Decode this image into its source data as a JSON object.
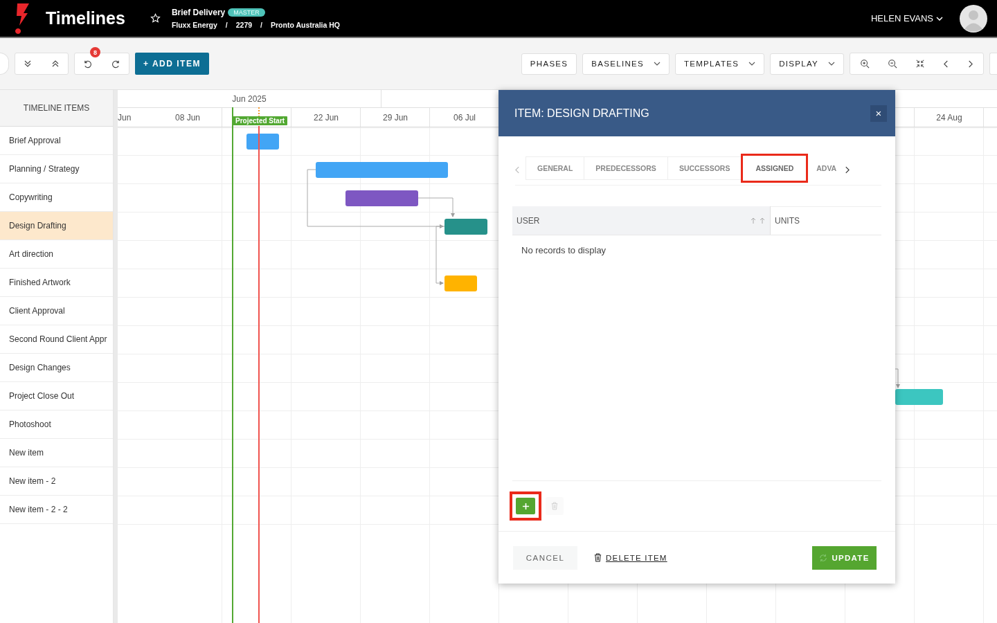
{
  "header": {
    "app_title": "Timelines",
    "project": "Brief Delivery",
    "badge": "MASTER",
    "breadcrumb": [
      "Fluxx Energy",
      "/",
      "2279",
      "/",
      "Pronto Australia HQ"
    ],
    "user": "HELEN EVANS"
  },
  "toolbar": {
    "undo_badge": "8",
    "add_item": "+ ADD ITEM",
    "buttons": [
      {
        "label": "PHASES",
        "dropdown": false
      },
      {
        "label": "BASELINES",
        "dropdown": true
      },
      {
        "label": "TEMPLATES",
        "dropdown": true
      },
      {
        "label": "DISPLAY",
        "dropdown": true
      }
    ]
  },
  "items_panel": {
    "heading": "TIMELINE ITEMS",
    "items": [
      {
        "label": "Brief Approval",
        "selected": false
      },
      {
        "label": "Planning / Strategy",
        "selected": false
      },
      {
        "label": "Copywriting",
        "selected": false
      },
      {
        "label": "Design Drafting",
        "selected": true
      },
      {
        "label": "Art direction",
        "selected": false
      },
      {
        "label": "Finished Artwork",
        "selected": false
      },
      {
        "label": "Client Approval",
        "selected": false
      },
      {
        "label": "Second Round Client Appr",
        "selected": false
      },
      {
        "label": "Design Changes",
        "selected": false
      },
      {
        "label": "Project Close Out",
        "selected": false
      },
      {
        "label": "Photoshoot",
        "selected": false
      },
      {
        "label": "New item",
        "selected": false
      },
      {
        "label": "New item - 2",
        "selected": false
      },
      {
        "label": "New item - 2 - 2",
        "selected": false
      }
    ]
  },
  "timeline": {
    "month": "Jun 2025",
    "dates": [
      "Jun",
      "08 Jun",
      "22 Jun",
      "29 Jun",
      "06 Jul",
      "24 Aug"
    ],
    "marker": "Projected Start",
    "bars": [
      {
        "color": "#42a5f5"
      },
      {
        "color": "#42a5f5"
      },
      {
        "color": "#7e57c2"
      },
      {
        "color": "#26918a"
      },
      {
        "color": "#ffb300"
      },
      {
        "color": "#3cc6c0"
      }
    ]
  },
  "modal": {
    "title": "ITEM: DESIGN DRAFTING",
    "close": "×",
    "tabs": [
      {
        "label": "GENERAL",
        "selected": false,
        "highlighted": false
      },
      {
        "label": "PREDECESSORS",
        "selected": false,
        "highlighted": false
      },
      {
        "label": "SUCCESSORS",
        "selected": false,
        "highlighted": false
      },
      {
        "label": "ASSIGNED",
        "selected": true,
        "highlighted": true
      },
      {
        "label": "ADVA",
        "selected": false,
        "highlighted": false
      }
    ],
    "columns": [
      "USER",
      "UNITS"
    ],
    "empty": "No records to display",
    "add_highlighted": true,
    "cancel": "CANCEL",
    "delete": "DELETE ITEM",
    "update": "UPDATE"
  }
}
